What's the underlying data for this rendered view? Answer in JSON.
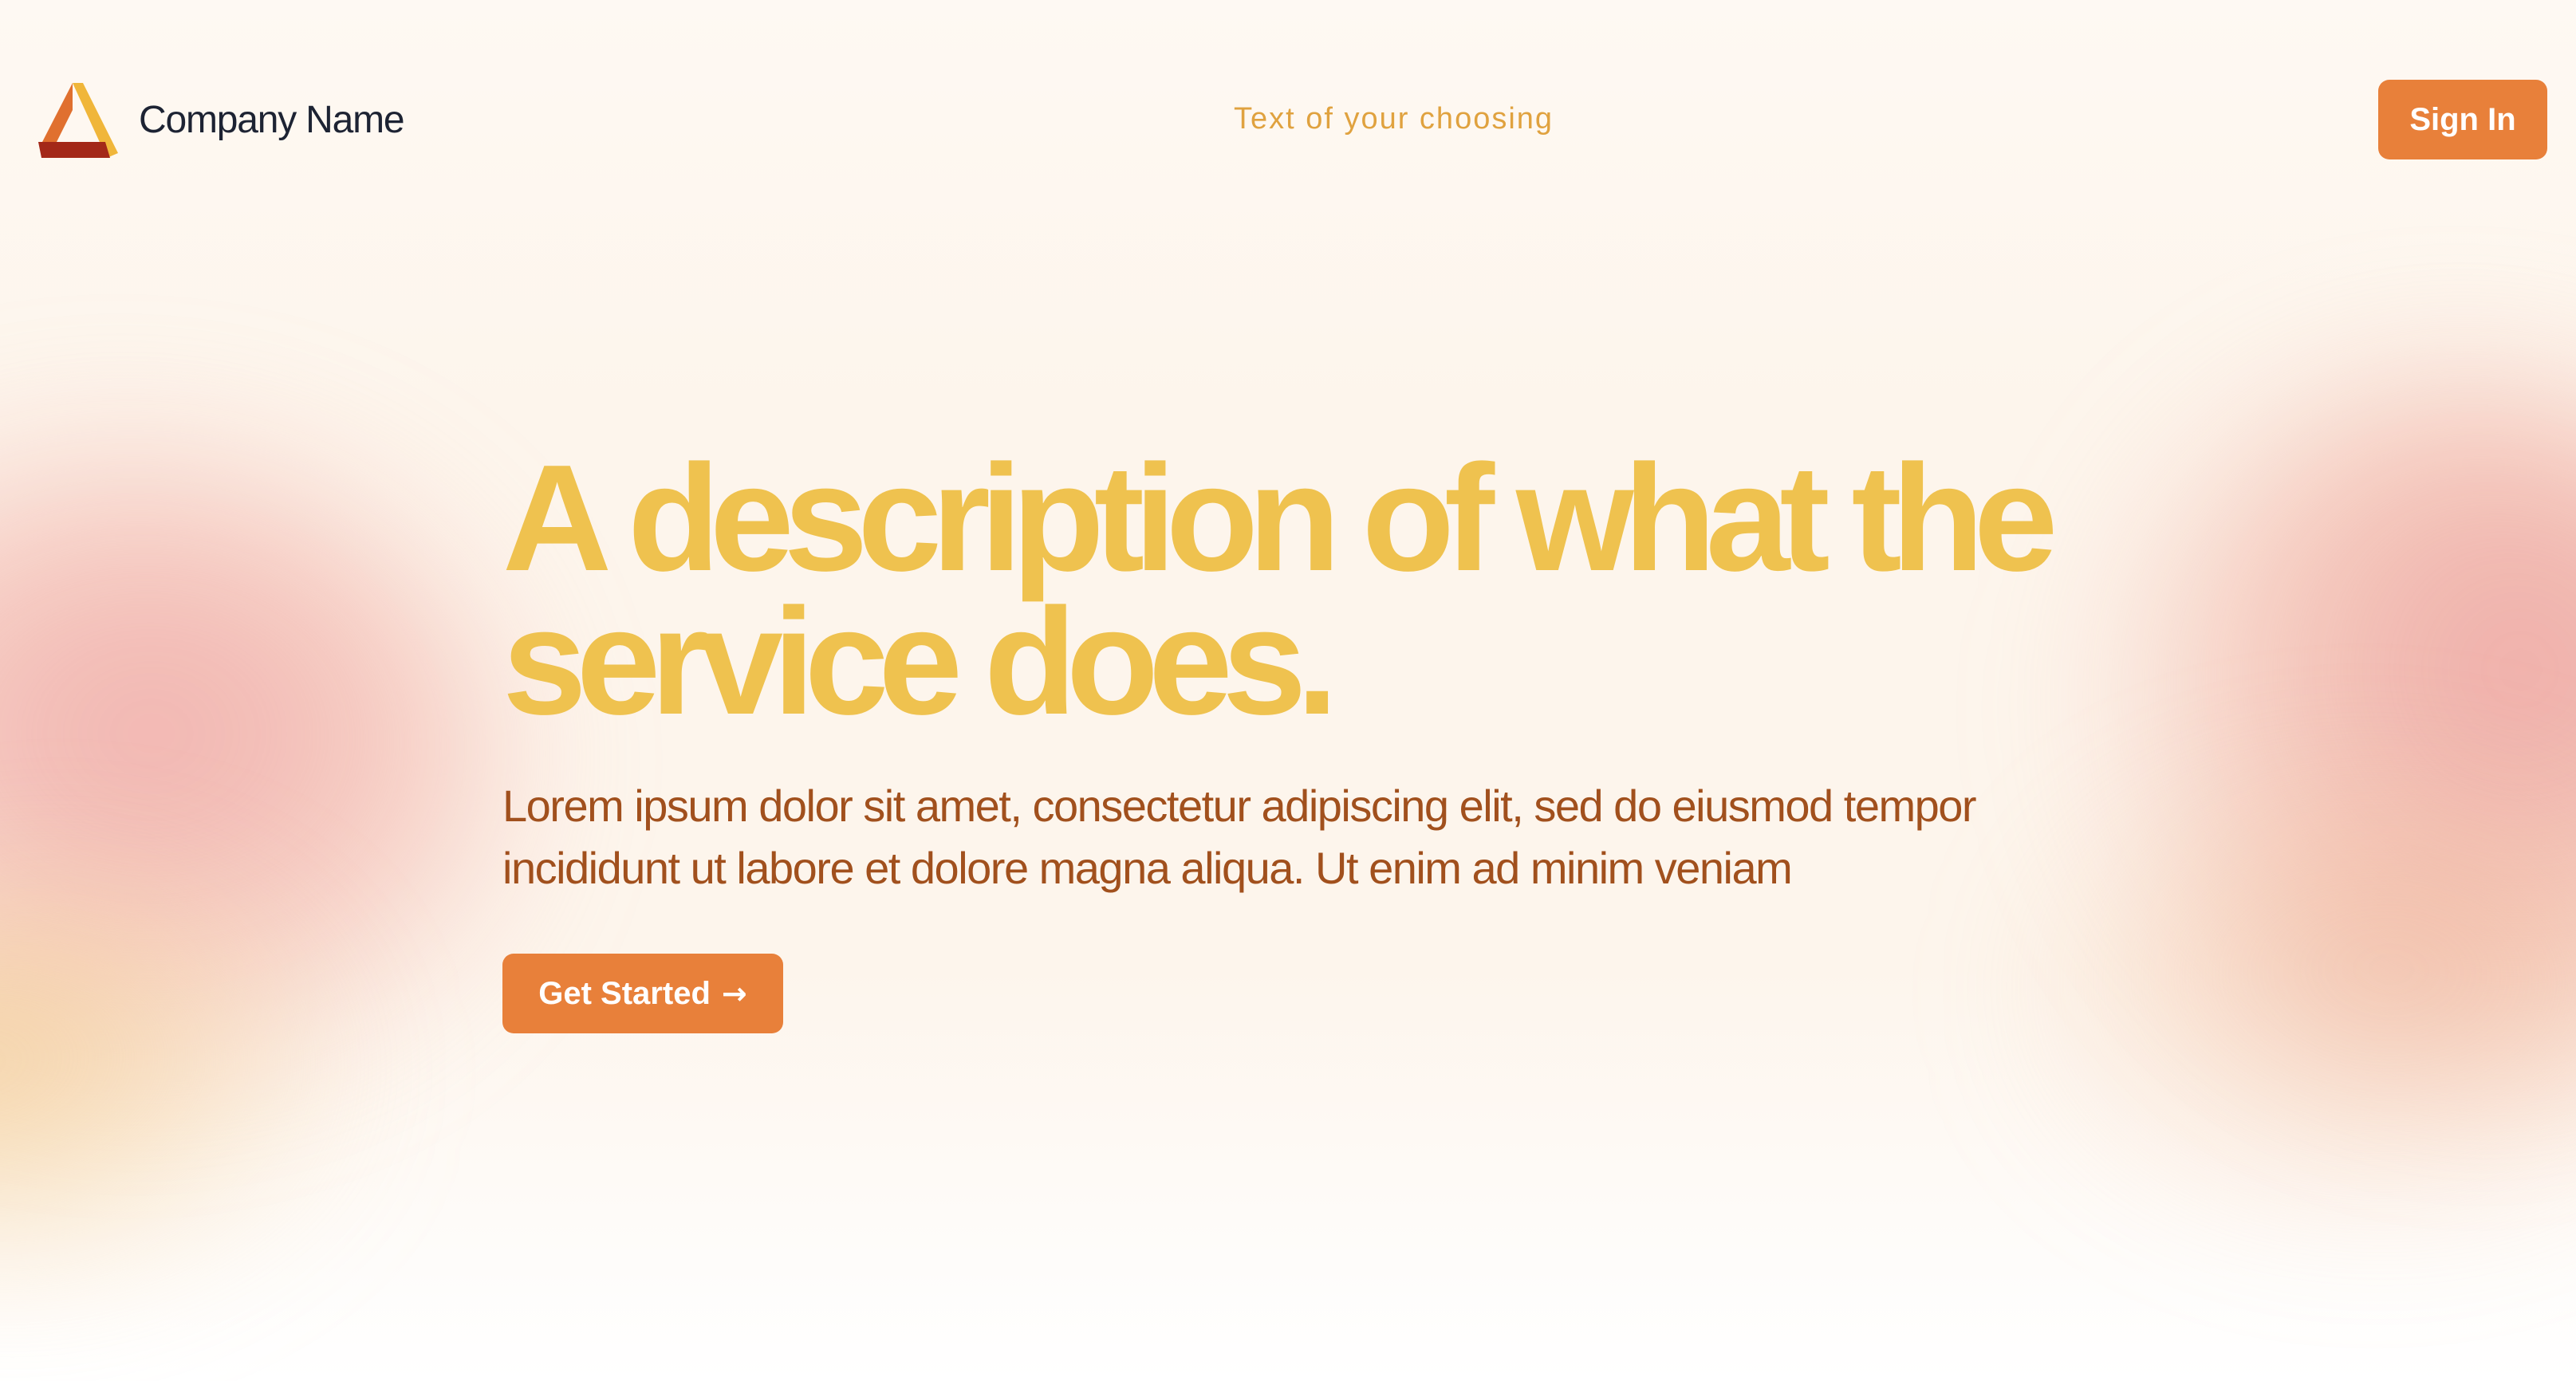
{
  "header": {
    "company_name": "Company Name",
    "logo_icon": "triangle-logo-icon",
    "tagline": "Text of your choosing",
    "signin_label": "Sign In"
  },
  "hero": {
    "title": "A description of what the service does.",
    "description": "Lorem ipsum dolor sit amet, consectetur adipiscing elit, sed do eiusmod tempor incididunt ut labore et dolore magna aliqua. Ut enim ad minim veniam",
    "cta_label": "Get Started",
    "cta_icon": "arrow-right-icon",
    "cta_arrow": "→"
  },
  "colors": {
    "accent": "#e8803a",
    "title": "#efc24f",
    "tagline": "#e0a23f",
    "description": "#a1501d",
    "brand_text": "#1d2333"
  }
}
